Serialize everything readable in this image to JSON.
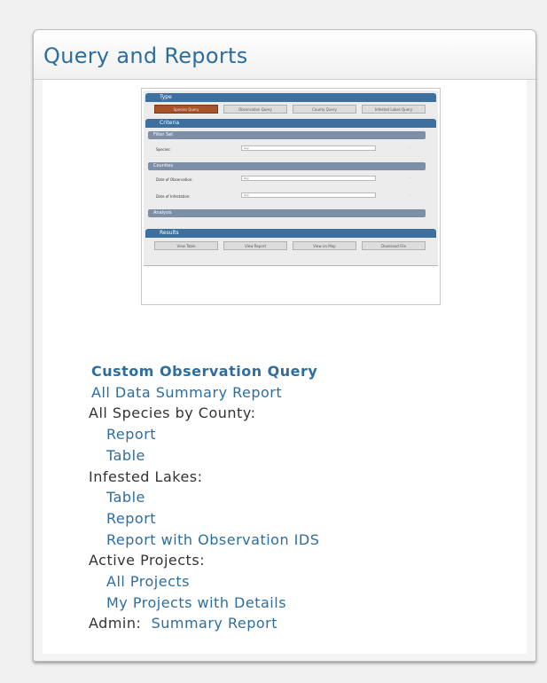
{
  "panel": {
    "title": "Query and Reports"
  },
  "thumbnail": {
    "type_header": "Type",
    "type_buttons": [
      "Species Query",
      "Observation Query",
      "County Query",
      "Infested Lakes Query"
    ],
    "criteria_header": "Criteria",
    "subsections": [
      "Filter Set",
      "Counties",
      "Analysis"
    ],
    "fields": [
      {
        "label": "Species:",
        "value": "Any"
      },
      {
        "label": "Date of Observation:",
        "value": "Any"
      },
      {
        "label": "Date of Infestation:",
        "value": "Any"
      }
    ],
    "results_header": "Results",
    "result_buttons": [
      "View Table",
      "View Report",
      "View on Map",
      "Download File"
    ]
  },
  "links": {
    "custom_query": "Custom Observation Query",
    "all_data_summary": "All Data Summary Report",
    "species_by_county_label": "All Species by County:",
    "species_by_county_report": "Report",
    "species_by_county_table": "Table",
    "infested_lakes_label": "Infested Lakes:",
    "infested_lakes_table": "Table",
    "infested_lakes_report": "Report",
    "infested_lakes_report_ids": "Report with Observation IDS",
    "active_projects_label": "Active Projects:",
    "all_projects": "All Projects",
    "my_projects": "My Projects with Details",
    "admin_label": "Admin:",
    "admin_summary": "Summary Report"
  },
  "colors": {
    "title_blue": "#2d6e9e",
    "link_blue": "#2d6e9e",
    "section_blue": "#3d6f9f",
    "active_orange": "#a8532a"
  }
}
